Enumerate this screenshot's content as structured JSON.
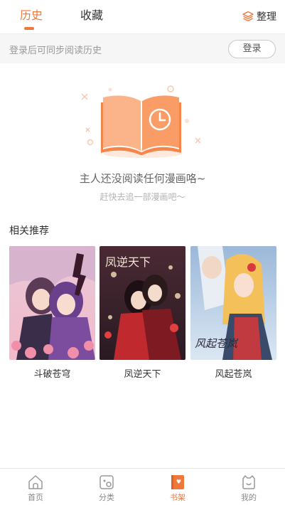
{
  "tabs": {
    "history": "历史",
    "favorites": "收藏",
    "organize": "整理"
  },
  "login": {
    "hint": "登录后可同步阅读历史",
    "button": "登录"
  },
  "empty_state": {
    "title": "主人还没阅读任何漫画咯~",
    "subtitle": "赶快去追一部漫画吧〜"
  },
  "recommend": {
    "heading": "相关推荐",
    "items": [
      {
        "title": "斗破苍穹"
      },
      {
        "title": "凤逆天下"
      },
      {
        "title": "风起苍岚"
      }
    ]
  },
  "bottom_nav": {
    "home": "首页",
    "category": "分类",
    "bookshelf": "书架",
    "mine": "我的"
  },
  "colors": {
    "accent": "#f0773a",
    "muted": "#999999"
  },
  "icons": [
    "layers-icon",
    "book-clock-icon",
    "home-icon",
    "category-icon",
    "bookshelf-icon",
    "smiley-icon"
  ]
}
